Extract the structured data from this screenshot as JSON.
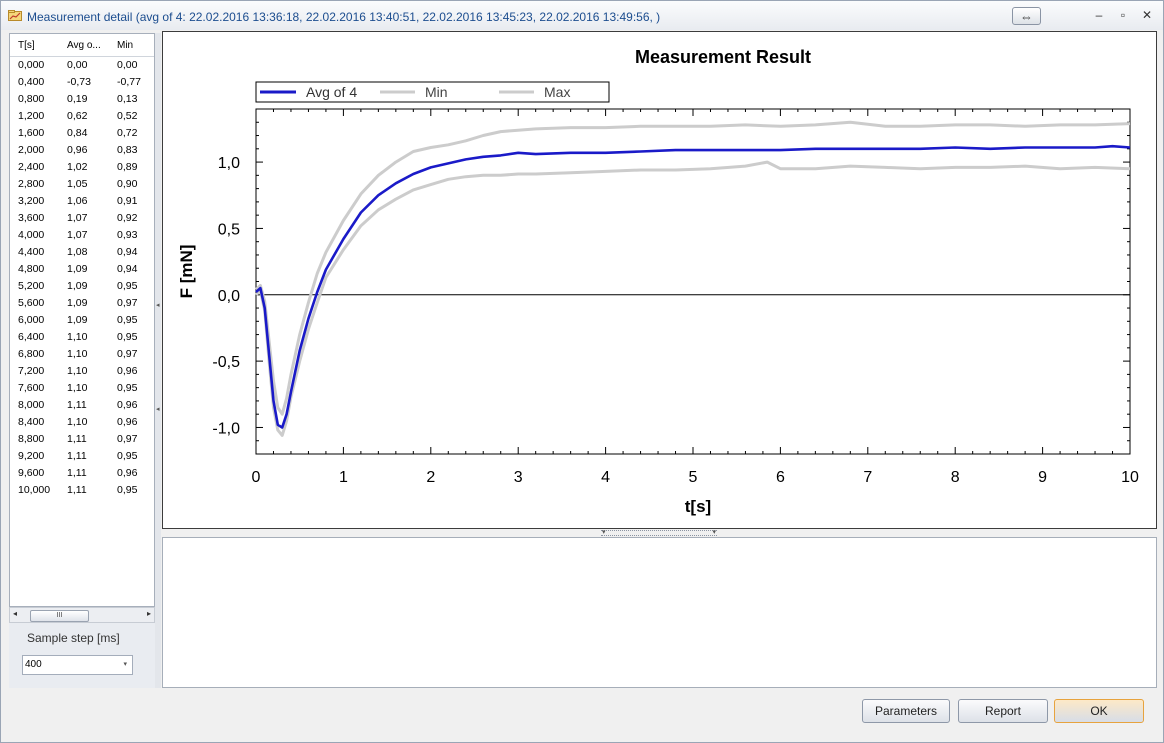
{
  "window": {
    "title": "Measurement detail (avg of 4: 22.02.2016 13:36:18, 22.02.2016 13:40:51, 22.02.2016 13:45:23, 22.02.2016 13:49:56, )",
    "resize_glyph": "⇔",
    "minimize_glyph": "–",
    "maximize_glyph": "▫",
    "close_glyph": "✕"
  },
  "table": {
    "headers": [
      "T[s]",
      "Avg o...",
      "Min"
    ],
    "rows": [
      [
        "0,000",
        "0,00",
        "0,00"
      ],
      [
        "0,400",
        "-0,73",
        "-0,77"
      ],
      [
        "0,800",
        "0,19",
        "0,13"
      ],
      [
        "1,200",
        "0,62",
        "0,52"
      ],
      [
        "1,600",
        "0,84",
        "0,72"
      ],
      [
        "2,000",
        "0,96",
        "0,83"
      ],
      [
        "2,400",
        "1,02",
        "0,89"
      ],
      [
        "2,800",
        "1,05",
        "0,90"
      ],
      [
        "3,200",
        "1,06",
        "0,91"
      ],
      [
        "3,600",
        "1,07",
        "0,92"
      ],
      [
        "4,000",
        "1,07",
        "0,93"
      ],
      [
        "4,400",
        "1,08",
        "0,94"
      ],
      [
        "4,800",
        "1,09",
        "0,94"
      ],
      [
        "5,200",
        "1,09",
        "0,95"
      ],
      [
        "5,600",
        "1,09",
        "0,97"
      ],
      [
        "6,000",
        "1,09",
        "0,95"
      ],
      [
        "6,400",
        "1,10",
        "0,95"
      ],
      [
        "6,800",
        "1,10",
        "0,97"
      ],
      [
        "7,200",
        "1,10",
        "0,96"
      ],
      [
        "7,600",
        "1,10",
        "0,95"
      ],
      [
        "8,000",
        "1,11",
        "0,96"
      ],
      [
        "8,400",
        "1,10",
        "0,96"
      ],
      [
        "8,800",
        "1,11",
        "0,97"
      ],
      [
        "9,200",
        "1,11",
        "0,95"
      ],
      [
        "9,600",
        "1,11",
        "0,96"
      ],
      [
        "10,000",
        "1,11",
        "0,95"
      ]
    ],
    "scroll_left_glyph": "◂",
    "scroll_right_glyph": "▸",
    "scroll_thumb_glyph": "III"
  },
  "sample_step": {
    "label": "Sample step [ms]",
    "value": "400",
    "arrow_glyph": "▾"
  },
  "splitter": {
    "grip_glyph": "◂",
    "down_glyph": "▾"
  },
  "buttons": {
    "parameters": "Parameters",
    "report": "Report",
    "ok": "OK"
  },
  "chart_data": {
    "type": "line",
    "title": "Measurement Result",
    "xlabel": "t[s]",
    "ylabel": "F [mN]",
    "xlim": [
      0,
      10
    ],
    "ylim": [
      -1.2,
      1.4
    ],
    "x_ticks": [
      0,
      1,
      2,
      3,
      4,
      5,
      6,
      7,
      8,
      9,
      10
    ],
    "x_tick_labels": [
      "0",
      "1",
      "2",
      "3",
      "4",
      "5",
      "6",
      "7",
      "8",
      "9",
      "10"
    ],
    "y_ticks": [
      1.0,
      0.5,
      0.0,
      -0.5,
      -1.0
    ],
    "y_tick_labels": [
      "1,0",
      "0,5",
      "0,0",
      "-0,5",
      "-1,0"
    ],
    "grid": false,
    "zero_line": true,
    "legend_position": "top-left",
    "series": [
      {
        "name": "Avg of 4",
        "color": "#1a1ac8",
        "x": [
          0,
          0.05,
          0.1,
          0.15,
          0.2,
          0.25,
          0.3,
          0.35,
          0.4,
          0.5,
          0.6,
          0.7,
          0.8,
          1.0,
          1.2,
          1.4,
          1.6,
          1.8,
          2.0,
          2.2,
          2.4,
          2.6,
          2.8,
          3.0,
          3.2,
          3.6,
          4.0,
          4.4,
          4.8,
          5.2,
          5.6,
          6.0,
          6.4,
          6.8,
          7.2,
          7.6,
          8.0,
          8.4,
          8.8,
          9.2,
          9.6,
          9.8,
          10.0
        ],
        "y": [
          0.02,
          0.05,
          -0.1,
          -0.45,
          -0.8,
          -0.98,
          -1.0,
          -0.9,
          -0.73,
          -0.42,
          -0.18,
          0.02,
          0.19,
          0.42,
          0.62,
          0.75,
          0.84,
          0.91,
          0.96,
          0.99,
          1.02,
          1.04,
          1.05,
          1.07,
          1.06,
          1.07,
          1.07,
          1.08,
          1.09,
          1.09,
          1.09,
          1.09,
          1.1,
          1.1,
          1.1,
          1.1,
          1.11,
          1.1,
          1.11,
          1.11,
          1.11,
          1.12,
          1.11
        ]
      },
      {
        "name": "Min",
        "color": "#cccccc",
        "x": [
          0,
          0.05,
          0.1,
          0.15,
          0.2,
          0.25,
          0.3,
          0.35,
          0.4,
          0.5,
          0.6,
          0.7,
          0.8,
          1.0,
          1.2,
          1.4,
          1.6,
          1.8,
          2.0,
          2.2,
          2.4,
          2.6,
          2.8,
          3.0,
          3.2,
          3.6,
          4.0,
          4.4,
          4.8,
          5.2,
          5.6,
          5.85,
          6.0,
          6.4,
          6.8,
          7.2,
          7.6,
          8.0,
          8.4,
          8.8,
          9.2,
          9.6,
          10.0
        ],
        "y": [
          0.0,
          0.03,
          -0.12,
          -0.5,
          -0.85,
          -1.02,
          -1.06,
          -0.95,
          -0.77,
          -0.5,
          -0.26,
          -0.06,
          0.13,
          0.34,
          0.52,
          0.64,
          0.72,
          0.79,
          0.83,
          0.87,
          0.89,
          0.9,
          0.9,
          0.91,
          0.91,
          0.92,
          0.93,
          0.94,
          0.94,
          0.95,
          0.97,
          1.0,
          0.95,
          0.95,
          0.97,
          0.96,
          0.95,
          0.96,
          0.96,
          0.97,
          0.95,
          0.96,
          0.95
        ]
      },
      {
        "name": "Max",
        "color": "#cccccc",
        "x": [
          0,
          0.05,
          0.1,
          0.15,
          0.2,
          0.25,
          0.3,
          0.35,
          0.4,
          0.5,
          0.6,
          0.7,
          0.8,
          1.0,
          1.2,
          1.4,
          1.6,
          1.8,
          2.0,
          2.2,
          2.4,
          2.6,
          2.8,
          3.0,
          3.2,
          3.6,
          4.0,
          4.4,
          4.8,
          5.2,
          5.6,
          6.0,
          6.4,
          6.8,
          7.2,
          7.6,
          8.0,
          8.4,
          8.8,
          9.2,
          9.6,
          10.0
        ],
        "y": [
          0.04,
          0.07,
          -0.05,
          -0.35,
          -0.65,
          -0.85,
          -0.9,
          -0.78,
          -0.6,
          -0.3,
          -0.06,
          0.16,
          0.32,
          0.56,
          0.76,
          0.9,
          1.0,
          1.08,
          1.11,
          1.13,
          1.16,
          1.2,
          1.23,
          1.24,
          1.25,
          1.26,
          1.26,
          1.27,
          1.27,
          1.27,
          1.28,
          1.27,
          1.28,
          1.3,
          1.27,
          1.27,
          1.28,
          1.28,
          1.27,
          1.28,
          1.28,
          1.29
        ]
      }
    ]
  }
}
